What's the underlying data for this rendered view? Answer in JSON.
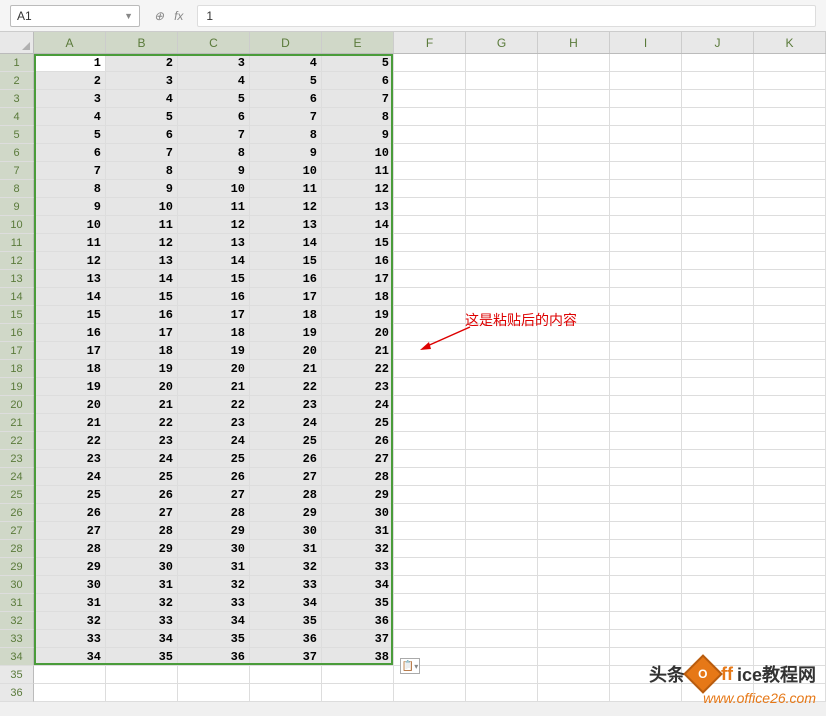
{
  "formula_bar": {
    "name_box": "A1",
    "fx_label": "fx",
    "formula_value": "1"
  },
  "columns": [
    "A",
    "B",
    "C",
    "D",
    "E",
    "F",
    "G",
    "H",
    "I",
    "J",
    "K"
  ],
  "selected_cols": [
    "A",
    "B",
    "C",
    "D",
    "E"
  ],
  "row_count": 36,
  "selected_rows_end": 34,
  "active_cell": "A1",
  "chart_data": {
    "type": "table",
    "title": "",
    "columns": [
      "A",
      "B",
      "C",
      "D",
      "E"
    ],
    "rows": [
      [
        1,
        2,
        3,
        4,
        5
      ],
      [
        2,
        3,
        4,
        5,
        6
      ],
      [
        3,
        4,
        5,
        6,
        7
      ],
      [
        4,
        5,
        6,
        7,
        8
      ],
      [
        5,
        6,
        7,
        8,
        9
      ],
      [
        6,
        7,
        8,
        9,
        10
      ],
      [
        7,
        8,
        9,
        10,
        11
      ],
      [
        8,
        9,
        10,
        11,
        12
      ],
      [
        9,
        10,
        11,
        12,
        13
      ],
      [
        10,
        11,
        12,
        13,
        14
      ],
      [
        11,
        12,
        13,
        14,
        15
      ],
      [
        12,
        13,
        14,
        15,
        16
      ],
      [
        13,
        14,
        15,
        16,
        17
      ],
      [
        14,
        15,
        16,
        17,
        18
      ],
      [
        15,
        16,
        17,
        18,
        19
      ],
      [
        16,
        17,
        18,
        19,
        20
      ],
      [
        17,
        18,
        19,
        20,
        21
      ],
      [
        18,
        19,
        20,
        21,
        22
      ],
      [
        19,
        20,
        21,
        22,
        23
      ],
      [
        20,
        21,
        22,
        23,
        24
      ],
      [
        21,
        22,
        23,
        24,
        25
      ],
      [
        22,
        23,
        24,
        25,
        26
      ],
      [
        23,
        24,
        25,
        26,
        27
      ],
      [
        24,
        25,
        26,
        27,
        28
      ],
      [
        25,
        26,
        27,
        28,
        29
      ],
      [
        26,
        27,
        28,
        29,
        30
      ],
      [
        27,
        28,
        29,
        30,
        31
      ],
      [
        28,
        29,
        30,
        31,
        32
      ],
      [
        29,
        30,
        31,
        32,
        33
      ],
      [
        30,
        31,
        32,
        33,
        34
      ],
      [
        31,
        32,
        33,
        34,
        35
      ],
      [
        32,
        33,
        34,
        35,
        36
      ],
      [
        33,
        34,
        35,
        36,
        37
      ],
      [
        34,
        35,
        36,
        37,
        38
      ]
    ]
  },
  "annotation": {
    "text": "这是粘贴后的内容"
  },
  "paste_options": {
    "icon": "📋"
  },
  "watermark": {
    "prefix": "头条",
    "brand1": "ff",
    "brand2": "ice教程网",
    "url": "www.office26.com"
  }
}
